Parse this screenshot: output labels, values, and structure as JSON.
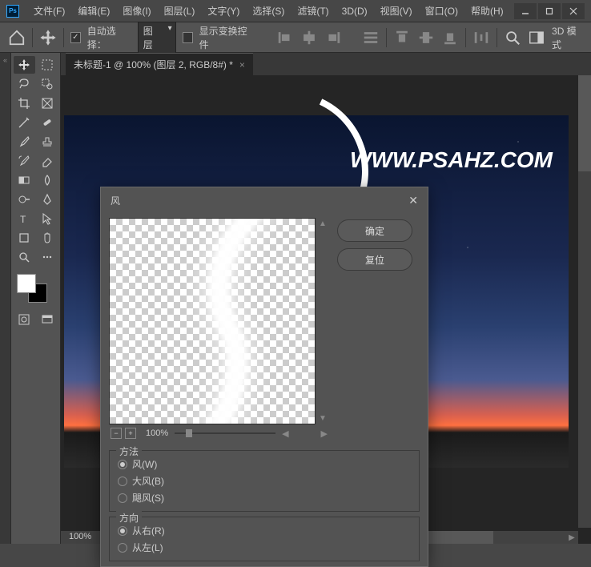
{
  "app": {
    "logo": "Ps"
  },
  "menu": {
    "file": "文件(F)",
    "edit": "编辑(E)",
    "image": "图像(I)",
    "layer": "图层(L)",
    "type": "文字(Y)",
    "select": "选择(S)",
    "filter": "滤镜(T)",
    "threeD": "3D(D)",
    "view": "视图(V)",
    "window": "窗口(O)",
    "help": "帮助(H)"
  },
  "options": {
    "auto_select": "自动选择：",
    "layer_mode": "图层",
    "show_transform": "显示变换控件",
    "mode3d": "3D 模式"
  },
  "tab": {
    "title": "未标题-1 @ 100% (图层 2, RGB/8#) *"
  },
  "canvas": {
    "watermark": "WWW.PSAHZ.COM",
    "zoom": "100%"
  },
  "dialog": {
    "title": "风",
    "ok": "确定",
    "reset": "复位",
    "preview_zoom": "100%",
    "method": {
      "title": "方法",
      "wind": "风(W)",
      "blast": "大风(B)",
      "stagger": "飓风(S)"
    },
    "direction": {
      "title": "方向",
      "from_right": "从右(R)",
      "from_left": "从左(L)"
    }
  }
}
